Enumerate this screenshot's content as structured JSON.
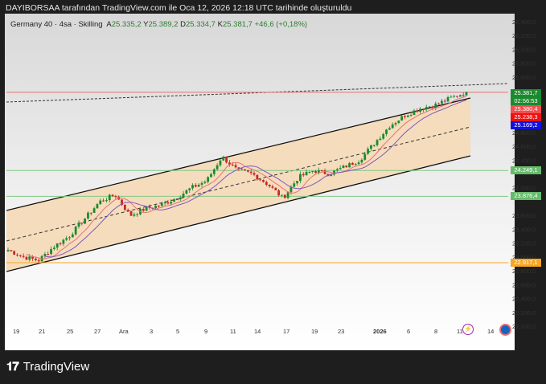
{
  "caption": "DAYIBORSAA tarafından TradingView.com ile Oca 12, 2026 12:18 UTC tarihinde oluşturuldu",
  "legend": {
    "symbol": "Germany 40 · 4sa · Skilling",
    "open_label": "A",
    "open": "25.335,2",
    "high_label": "Y",
    "high": "25.389,2",
    "low_label": "D",
    "low": "25.334,7",
    "close_label": "K",
    "close": "25.381,7",
    "change": "+46,6 (+0,18%)"
  },
  "price_axis": [
    "26.400,0",
    "26.200,0",
    "26.000,0",
    "25.800,0",
    "25.600,0",
    "24.800,0",
    "24.600,0",
    "24.400,0",
    "24.000,0",
    "23.600,0",
    "23.400,0",
    "23.200,0",
    "23.000,0",
    "22.800,0",
    "22.600,0",
    "22.400,0",
    "22.200,0",
    "22.000,0"
  ],
  "price_axis_values": [
    26400,
    26200,
    26000,
    25800,
    25600,
    24800,
    24600,
    24400,
    24000,
    23600,
    23400,
    23200,
    23000,
    22800,
    22600,
    22400,
    22200,
    22000
  ],
  "tags": [
    {
      "label": "25.381,7",
      "sub": "02:56:53",
      "value": 25381.7,
      "color": "#1b8a2e"
    },
    {
      "label": "25.380,4",
      "value": 25280,
      "color": "#f0504f"
    },
    {
      "label": "25.238,3",
      "value": 25238.3,
      "color": "#f01010"
    },
    {
      "label": "25.169,2",
      "value": 25169.2,
      "color": "#1010e0"
    },
    {
      "label": "24.249,1",
      "value": 24249.1,
      "color": "#66bb6a"
    },
    {
      "label": "23.876,4",
      "value": 23876.4,
      "color": "#66bb6a"
    },
    {
      "label": "22.917,1",
      "value": 22917.1,
      "color": "#f5a623"
    }
  ],
  "time_axis": [
    "19",
    "21",
    "25",
    "27",
    "Ara",
    "3",
    "5",
    "9",
    "11",
    "14",
    "17",
    "19",
    "23",
    "2026",
    "6",
    "8",
    "11",
    "14"
  ],
  "branding": "TradingView",
  "chart_data": {
    "type": "candlestick",
    "title": "Germany 40 · 4sa · Skilling",
    "ylim": [
      22000,
      26400
    ],
    "close_keypoints": [
      23100,
      23000,
      22950,
      23150,
      23300,
      23550,
      23800,
      23900,
      23600,
      23700,
      23750,
      23850,
      24000,
      24100,
      24450,
      24250,
      24200,
      24050,
      23850,
      24150,
      24250,
      24200,
      24300,
      24400,
      24650,
      24900,
      25050,
      25150,
      25200,
      25300,
      25381.7
    ],
    "horizontal_levels": [
      25380.4,
      24249.1,
      23876.4,
      22917.1
    ],
    "colors": {
      "up": "#1b8a2e",
      "down": "#c62828",
      "ma_fast": "#e57373",
      "ma_slow": "#7e57c2",
      "channel_fill": "#f5dcbc"
    }
  }
}
